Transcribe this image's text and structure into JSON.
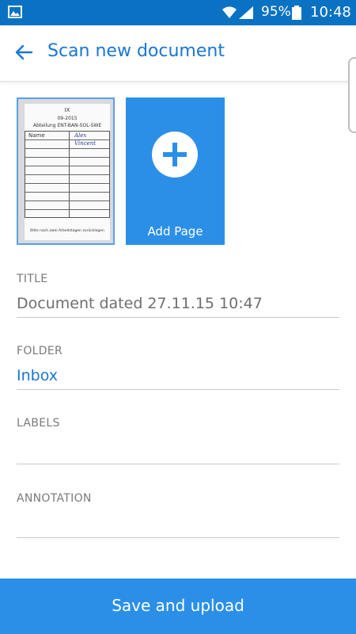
{
  "status_bar": {
    "battery_percent": "95%",
    "time": "10:48",
    "icons": [
      "image-notification-icon",
      "wifi-icon",
      "signal-icon",
      "battery-icon"
    ]
  },
  "toolbar": {
    "title": "Scan new document",
    "back_icon": "arrow-left-icon"
  },
  "pages": {
    "thumbnail": {
      "lines": [
        "IX",
        "09-2015",
        "Abteilung ENT-BAN-SOL-SWE"
      ],
      "table_header_left": "Name",
      "handwriting_1": "Alex",
      "handwriting_2": "Vincent",
      "footer_note": "Bitte nach zwei Arbeitstagen zurücklegen"
    },
    "add_page_label": "Add Page",
    "add_icon": "plus-icon"
  },
  "form": {
    "title": {
      "label": "TITLE",
      "value": "Document dated 27.11.15 10:47"
    },
    "folder": {
      "label": "FOLDER",
      "value": "Inbox"
    },
    "labels": {
      "label": "LABELS",
      "value": ""
    },
    "annotation": {
      "label": "ANNOTATION",
      "value": ""
    }
  },
  "save_button": {
    "label": "Save and upload"
  },
  "colors": {
    "status_bar": "#0a72c2",
    "accent": "#2b8fe8",
    "title_text": "#1976d2"
  }
}
